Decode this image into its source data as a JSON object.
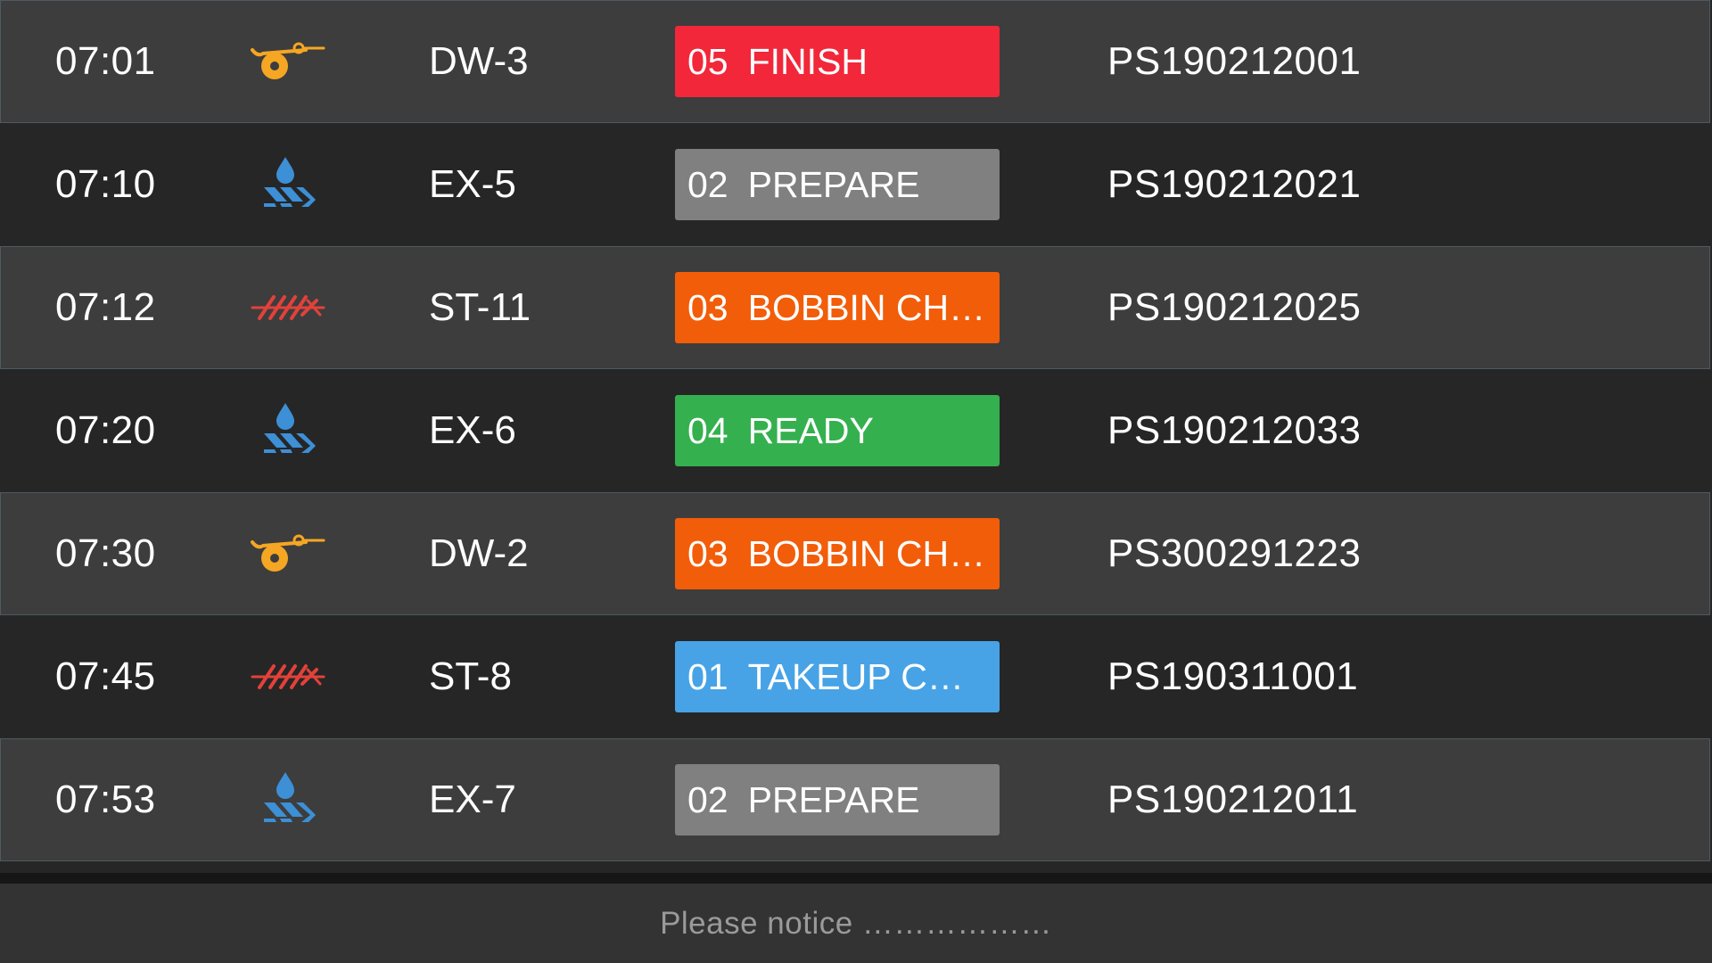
{
  "rows": [
    {
      "time": "07:01",
      "icon": "winding-spool-icon",
      "machine": "DW-3",
      "status_code": "05",
      "status_label": "FINISH",
      "status_color": "#f2273a",
      "order": "PS190212001"
    },
    {
      "time": "07:10",
      "icon": "extruder-drop-icon",
      "machine": "EX-5",
      "status_code": "02",
      "status_label": "PREPARE",
      "status_color": "#808080",
      "order": "PS190212021"
    },
    {
      "time": "07:12",
      "icon": "stranding-wire-icon",
      "machine": "ST-11",
      "status_code": "03",
      "status_label": "BOBBIN CHA...",
      "status_color": "#f25d0a",
      "order": "PS190212025"
    },
    {
      "time": "07:20",
      "icon": "extruder-drop-icon",
      "machine": "EX-6",
      "status_code": "04",
      "status_label": "READY",
      "status_color": "#35b04f",
      "order": "PS190212033"
    },
    {
      "time": "07:30",
      "icon": "winding-spool-icon",
      "machine": "DW-2",
      "status_code": "03",
      "status_label": "BOBBIN CHA...",
      "status_color": "#f25d0a",
      "order": "PS300291223"
    },
    {
      "time": "07:45",
      "icon": "stranding-wire-icon",
      "machine": "ST-8",
      "status_code": "01",
      "status_label": "TAKEUP CHA...",
      "status_color": "#47a3e6",
      "order": "PS190311001"
    },
    {
      "time": "07:53",
      "icon": "extruder-drop-icon",
      "machine": "EX-7",
      "status_code": "02",
      "status_label": "PREPARE",
      "status_color": "#808080",
      "order": "PS190212011"
    }
  ],
  "footer": {
    "notice": "Please notice ………………"
  },
  "icon_colors": {
    "winding-spool-icon": "#f5a623",
    "extruder-drop-icon": "#3d8fd6",
    "stranding-wire-icon": "#e2413a"
  }
}
